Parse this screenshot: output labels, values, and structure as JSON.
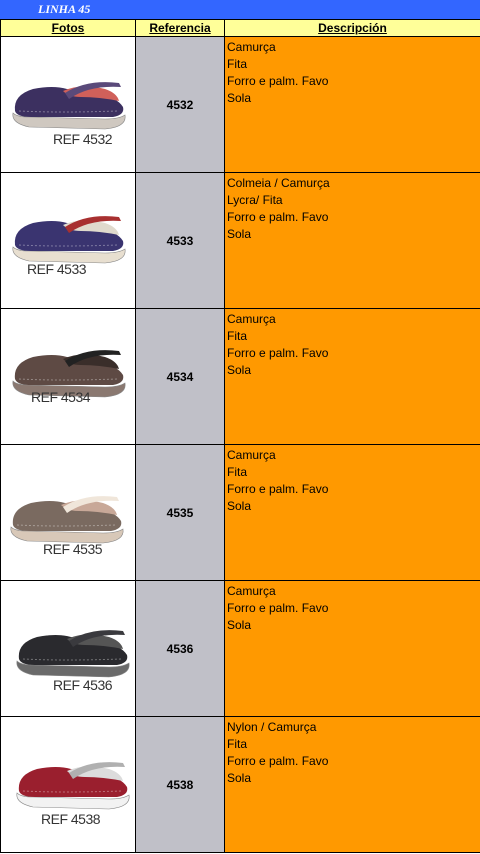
{
  "banner": {
    "title": "LINHA 45"
  },
  "table": {
    "headers": {
      "photos": "Fotos",
      "reference": "Referencia",
      "description": "Descripción"
    },
    "rows": [
      {
        "ref": "4532",
        "photo_label": "REF 4532",
        "description": [
          "Camurça",
          "Fita",
          "Forro e palm. Favo",
          "Sola"
        ],
        "shoe_icon": "purple-mary-jane-shoe-icon",
        "shoe_colors": {
          "upper": "#3c3060",
          "sole": "#cfc8c0",
          "strap": "#5a4a7a",
          "lining": "#d0605a"
        }
      },
      {
        "ref": "4533",
        "photo_label": "REF 4533",
        "description": [
          "Colmeia / Camurça",
          "Lycra/ Fita",
          "Forro e palm. Favo",
          "Sola"
        ],
        "shoe_icon": "navy-cross-strap-shoe-icon",
        "shoe_colors": {
          "upper": "#3a3470",
          "sole": "#e8dfd0",
          "strap": "#a83030",
          "lining": "#e0dacd"
        }
      },
      {
        "ref": "4534",
        "photo_label": "REF 4534",
        "description": [
          "Camurça",
          "Fita",
          "Forro e palm. Favo",
          "Sola"
        ],
        "shoe_icon": "brown-mary-jane-shoe-icon",
        "shoe_colors": {
          "upper": "#5e4a44",
          "sole": "#8a7870",
          "strap": "#222222",
          "lining": "#3a2e2a"
        }
      },
      {
        "ref": "4535",
        "photo_label": "REF 4535",
        "description": [
          "Camurça",
          "Fita",
          "Forro e palm. Favo",
          "Sola"
        ],
        "shoe_icon": "taupe-striped-slip-on-icon",
        "shoe_colors": {
          "upper": "#7a6a60",
          "sole": "#d8c8b8",
          "strap": "#f0e6da",
          "lining": "#c8a898"
        }
      },
      {
        "ref": "4536",
        "photo_label": "REF 4536",
        "description": [
          "Camurça",
          "Forro e palm. Favo",
          "Sola"
        ],
        "shoe_icon": "black-mary-jane-shoe-icon",
        "shoe_colors": {
          "upper": "#2a2a2e",
          "sole": "#6a6a6a",
          "strap": "#3a3a3e",
          "lining": "#555555"
        }
      },
      {
        "ref": "4538",
        "photo_label": "REF 4538",
        "description": [
          "Nylon / Camurça",
          "Fita",
          "Forro e palm. Favo",
          "Sola"
        ],
        "shoe_icon": "red-mesh-mary-jane-icon",
        "shoe_colors": {
          "upper": "#9a1f2e",
          "sole": "#f2f2f2",
          "strap": "#b0b0b0",
          "lining": "#dcdcdc"
        }
      }
    ]
  }
}
